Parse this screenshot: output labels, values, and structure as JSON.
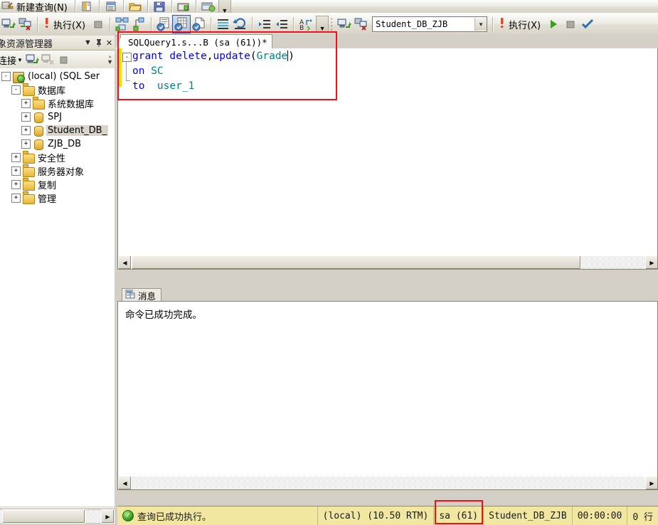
{
  "toolbar_top": {
    "new_query_label": "新建查询(N)",
    "icons": [
      "new-query-icon",
      "new-file-icon",
      "open-project-icon",
      "open-file-icon",
      "save-icon",
      "save-all-icon",
      "window-icon"
    ],
    "overflow_label": "▼"
  },
  "toolbar_main": {
    "connect_icon": "connect-object-explorer-icon",
    "disconnect_icon": "disconnect-object-explorer-icon",
    "execute_label": "执行(X)",
    "execute_bang_icon": "execute-exclamation-icon",
    "stop_icon": "stop-icon",
    "parse_icon": "parse-query-icon",
    "display_plan_icon": "display-estimated-plan-icon",
    "query_options_icon": "query-options-icon",
    "results_to_text_icon": "results-to-text-icon",
    "results_to_grid_icon": "results-to-grid-icon",
    "results_to_file_icon": "results-to-file-icon",
    "comment_icon": "comment-selection-icon",
    "uncomment_icon": "uncomment-selection-icon",
    "indent_icon": "decrease-indent-icon",
    "outdent_icon": "increase-indent-icon",
    "sort_icon": "sort-az-icon",
    "database_value": "Student_DB_ZJB",
    "database_placeholder": "Student_DB_ZJB",
    "run_green_icon": "run-green-arrow-icon",
    "stop2_icon": "stop-square-icon",
    "check_icon": "check-mark-icon",
    "overflow_label": "▼"
  },
  "object_explorer": {
    "caption": "象资源管理器",
    "caption_full": "对象资源管理器",
    "dropdown_icon": "chevron-down-icon",
    "pin_icon": "pin-icon",
    "close_icon": "close-icon",
    "connect_label": "连接",
    "connect_dropdown_icon": "chevron-down-icon",
    "tb_connect_icon": "connect-icon",
    "tb_disconnect_icon": "disconnect-icon",
    "tb_stop_icon": "stop-icon",
    "tb_overflow_icon": "toolbar-overflow-icon",
    "tree": [
      {
        "label": "(local) (SQL Ser",
        "expander": "-",
        "icon": "server-icon",
        "indent": 0,
        "selected": false
      },
      {
        "label": "数据库",
        "expander": "-",
        "icon": "folder-icon",
        "indent": 1,
        "selected": false
      },
      {
        "label": "系统数据库",
        "expander": "+",
        "icon": "folder-icon",
        "indent": 2,
        "selected": false
      },
      {
        "label": "SPJ",
        "expander": "+",
        "icon": "database-icon",
        "indent": 2,
        "selected": false
      },
      {
        "label": "Student_DB_",
        "expander": "+",
        "icon": "database-icon",
        "indent": 2,
        "selected": true
      },
      {
        "label": "ZJB_DB",
        "expander": "+",
        "icon": "database-icon",
        "indent": 2,
        "selected": false
      },
      {
        "label": "安全性",
        "expander": "+",
        "icon": "folder-icon",
        "indent": 1,
        "selected": false
      },
      {
        "label": "服务器对象",
        "expander": "+",
        "icon": "folder-icon",
        "indent": 1,
        "selected": false
      },
      {
        "label": "复制",
        "expander": "+",
        "icon": "folder-icon",
        "indent": 1,
        "selected": false
      },
      {
        "label": "管理",
        "expander": "+",
        "icon": "folder-icon",
        "indent": 1,
        "selected": false
      }
    ]
  },
  "editor": {
    "tab_title": "SQLQuery1.s...B (sa (61))*",
    "outline_glyph": "-",
    "code_lines": [
      [
        {
          "t": "grant delete",
          "c": "kw"
        },
        {
          "t": ",",
          "c": "pn"
        },
        {
          "t": "update",
          "c": "kw"
        },
        {
          "t": "(",
          "c": "pn"
        },
        {
          "t": "Grade",
          "c": "id"
        },
        {
          "t": ")",
          "c": "pn"
        }
      ],
      [
        {
          "t": "on ",
          "c": "kw"
        },
        {
          "t": "SC",
          "c": "id"
        }
      ],
      [
        {
          "t": "to  ",
          "c": "kw"
        },
        {
          "t": "user_1",
          "c": "id"
        }
      ]
    ],
    "scroll_left_icon": "scroll-left-arrow",
    "scroll_right_icon": "scroll-right-arrow"
  },
  "results": {
    "tab_label": "消息",
    "tab_icon": "messages-icon",
    "message_text": "命令已成功完成。"
  },
  "statusbar": {
    "status_icon": "success-check-icon",
    "status_text": "查询已成功执行。",
    "server": "(local) (10.50 RTM)",
    "login": "sa (61)",
    "database": "Student_DB_ZJB",
    "elapsed": "00:00:00",
    "rows": "0 行"
  },
  "colors": {
    "keyword": "#0000ff",
    "identifier": "#008080",
    "punctuation": "#000000",
    "annotation_red": "#fb0d18",
    "change_bar_yellow": "#fcdf01",
    "statusbar_bg": "#f2e7a0",
    "chrome_bg": "#d4d0c8",
    "selection_bg": "#d8d4cb"
  }
}
